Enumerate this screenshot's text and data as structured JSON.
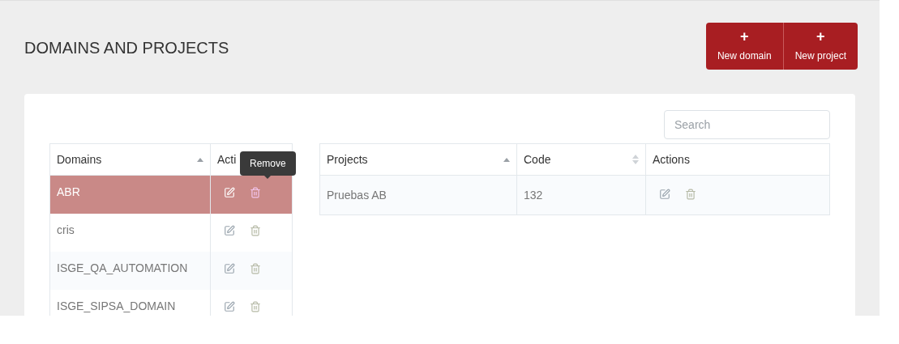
{
  "page_title": "DOMAINS AND PROJECTS",
  "header_buttons": [
    {
      "label": "New domain",
      "icon": "+"
    },
    {
      "label": "New project",
      "icon": "+"
    }
  ],
  "search": {
    "placeholder": "Search"
  },
  "domains_table": {
    "columns": [
      {
        "label": "Domains",
        "sortable": true,
        "sorted": true
      },
      {
        "label": "Acti",
        "sortable": false
      }
    ],
    "rows": [
      {
        "name": "ABR",
        "selected": true
      },
      {
        "name": "cris",
        "selected": false
      },
      {
        "name": "ISGE_QA_AUTOMATION",
        "selected": false
      },
      {
        "name": "ISGE_SIPSA_DOMAIN",
        "selected": false
      }
    ],
    "tooltip": "Remove"
  },
  "projects_table": {
    "columns": [
      {
        "label": "Projects",
        "sortable": true,
        "sorted": true
      },
      {
        "label": "Code",
        "sortable": true,
        "sorted": false
      },
      {
        "label": "Actions",
        "sortable": false
      }
    ],
    "rows": [
      {
        "name": "Pruebas AB",
        "code": "132"
      }
    ]
  }
}
